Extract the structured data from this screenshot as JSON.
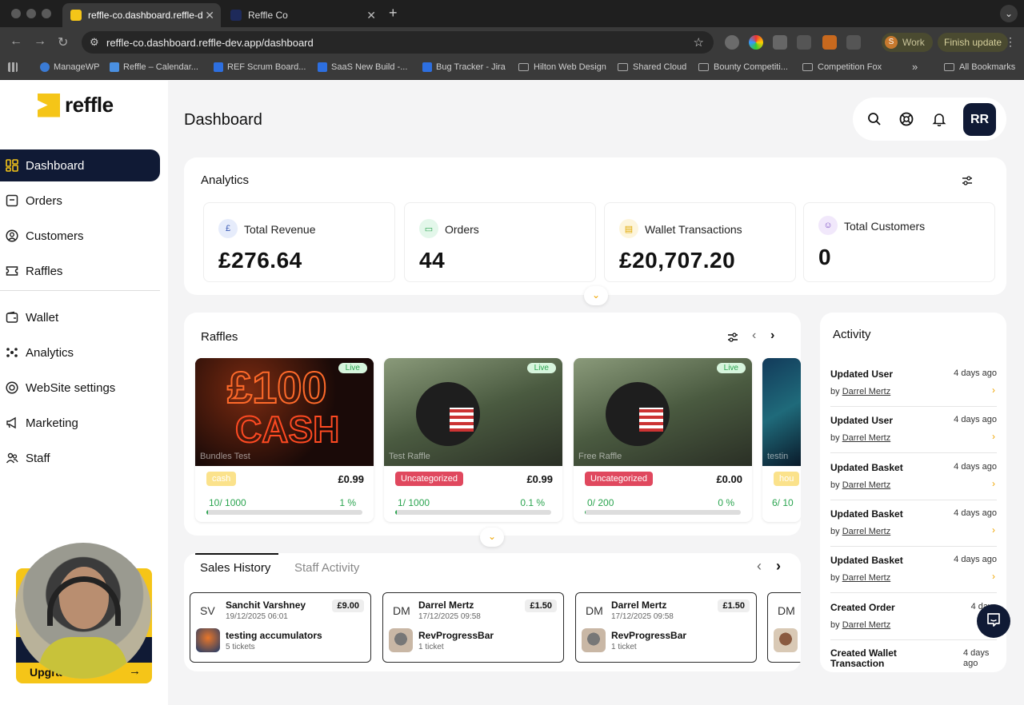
{
  "browser": {
    "tabs": [
      {
        "title": "reffle-co.dashboard.reffle-de",
        "active": true
      },
      {
        "title": "Reffle Co",
        "active": false
      }
    ],
    "url": "reffle-co.dashboard.reffle-dev.app/dashboard",
    "profile": {
      "initial": "S",
      "label": "Work"
    },
    "finish_update": "Finish update",
    "bookmarks": [
      "ManageWP",
      "Reffle – Calendar...",
      "REF Scrum Board...",
      "SaaS New Build -...",
      "Bug Tracker - Jira",
      "Hilton Web Design",
      "Shared Cloud",
      "Bounty Competiti...",
      "Competition Fox"
    ],
    "all_bookmarks": "All Bookmarks",
    "overflow": "»"
  },
  "brand": {
    "name": "reffle",
    "accent": "#f5c518",
    "navy": "#101a35"
  },
  "sidebar": {
    "items": [
      {
        "label": "Dashboard",
        "icon": "dashboard-icon"
      },
      {
        "label": "Orders",
        "icon": "orders-icon"
      },
      {
        "label": "Customers",
        "icon": "customers-icon"
      },
      {
        "label": "Raffles",
        "icon": "ticket-icon"
      },
      {
        "label": "Wallet",
        "icon": "wallet-icon"
      },
      {
        "label": "Analytics",
        "icon": "analytics-icon"
      },
      {
        "label": "WebSite settings",
        "icon": "website-icon"
      },
      {
        "label": "Marketing",
        "icon": "megaphone-icon"
      },
      {
        "label": "Staff",
        "icon": "staff-icon"
      }
    ],
    "upgrade_label": "Upgra",
    "upgrade_arrow": "→"
  },
  "header": {
    "title": "Dashboard",
    "avatar": "RR"
  },
  "analytics": {
    "title": "Analytics",
    "stats": [
      {
        "label": "Total Revenue",
        "value": "£276.64",
        "icon": "pound-icon"
      },
      {
        "label": "Orders",
        "value": "44",
        "icon": "orders-icon"
      },
      {
        "label": "Wallet Transactions",
        "value": "£20,707.20",
        "icon": "wallet-icon"
      },
      {
        "label": "Total Customers",
        "value": "0",
        "icon": "customer-icon"
      }
    ]
  },
  "raffles": {
    "title": "Raffles",
    "items": [
      {
        "name": "Bundles Test",
        "live": "Live",
        "category": "cash",
        "price": "£0.99",
        "sold": "10/ 1000",
        "pct": "1 %",
        "progress": 0.01
      },
      {
        "name": "Test Raffle",
        "live": "Live",
        "category": "Uncategorized",
        "price": "£0.99",
        "sold": "1/ 1000",
        "pct": "0.1 %",
        "progress": 0.001
      },
      {
        "name": "Free Raffle",
        "live": "Live",
        "category": "Uncategorized",
        "price": "£0.00",
        "sold": "0/ 200",
        "pct": "0 %",
        "progress": 0
      },
      {
        "name": "testin",
        "live": "",
        "category": "hou",
        "price": "",
        "sold": "6/ 10",
        "pct": "",
        "progress": 0.6
      }
    ]
  },
  "sales": {
    "tabs": [
      "Sales History",
      "Staff Activity"
    ],
    "items": [
      {
        "initials": "SV",
        "name": "Sanchit Varshney",
        "date": "19/12/2025 06:01",
        "amount": "£9.00",
        "item": "testing accumulators",
        "tickets": "5 tickets"
      },
      {
        "initials": "DM",
        "name": "Darrel Mertz",
        "date": "17/12/2025 09:58",
        "amount": "£1.50",
        "item": "RevProgressBar",
        "tickets": "1 ticket"
      },
      {
        "initials": "DM",
        "name": "Darrel Mertz",
        "date": "17/12/2025 09:58",
        "amount": "£1.50",
        "item": "RevProgressBar",
        "tickets": "1 ticket"
      },
      {
        "initials": "DM",
        "name": "",
        "date": "",
        "amount": "",
        "item": "",
        "tickets": ""
      }
    ]
  },
  "activity": {
    "title": "Activity",
    "items": [
      {
        "title": "Updated User",
        "time": "4 days ago",
        "by": "by",
        "user": "Darrel Mertz"
      },
      {
        "title": "Updated User",
        "time": "4 days ago",
        "by": "by",
        "user": "Darrel Mertz"
      },
      {
        "title": "Updated Basket",
        "time": "4 days ago",
        "by": "by",
        "user": "Darrel Mertz"
      },
      {
        "title": "Updated Basket",
        "time": "4 days ago",
        "by": "by",
        "user": "Darrel Mertz"
      },
      {
        "title": "Updated Basket",
        "time": "4 days ago",
        "by": "by",
        "user": "Darrel Mertz"
      },
      {
        "title": "Created Order",
        "time": "4 days",
        "by": "by",
        "user": "Darrel Mertz"
      },
      {
        "title": "Created Wallet Transaction",
        "time": "4 days ago",
        "by": "",
        "user": ""
      }
    ]
  }
}
